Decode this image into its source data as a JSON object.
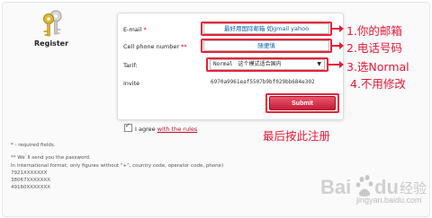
{
  "sidebar": {
    "register_label": "Register"
  },
  "form": {
    "email_label": "E-mail",
    "email_required": "*",
    "email_value": "最好用国际邮箱 如gmail yahoo",
    "phone_label": "Cell phone number",
    "phone_required": "**",
    "phone_value": "随便填",
    "tarif_label": "Tarif:",
    "tarif_value": "Normal",
    "tarif_note": "这个模式适合国内",
    "invite_label": "invite",
    "invite_value": "6970a9961eaf5507b9bf029bb684e302",
    "submit_label": "Submit",
    "agree_text": "I agree",
    "agree_link": "with the rules"
  },
  "annotations": {
    "a1": "1.你的邮箱",
    "a2": "2.电话号码",
    "a3": "3.选Normal",
    "a4": "4.不用修改",
    "a5": "最后按此注册"
  },
  "notes": {
    "line1_mark": "*",
    "line1": " - required fields.",
    "line2": "** We`ll send you the password.",
    "line3": "In international format; only figures without \"+\", country code, operator code, phone)",
    "line4": "7921XXXXXXX",
    "line5": "38067XXXXXXX",
    "line6": "49160XXXXXXX"
  },
  "watermark": {
    "brand": "Bai",
    "brand2": "经验",
    "url": "jingyan.baidu.com"
  },
  "colors": {
    "accent_red": "#e31936",
    "submit_red": "#c41d3a",
    "link_red": "#b8102a"
  }
}
